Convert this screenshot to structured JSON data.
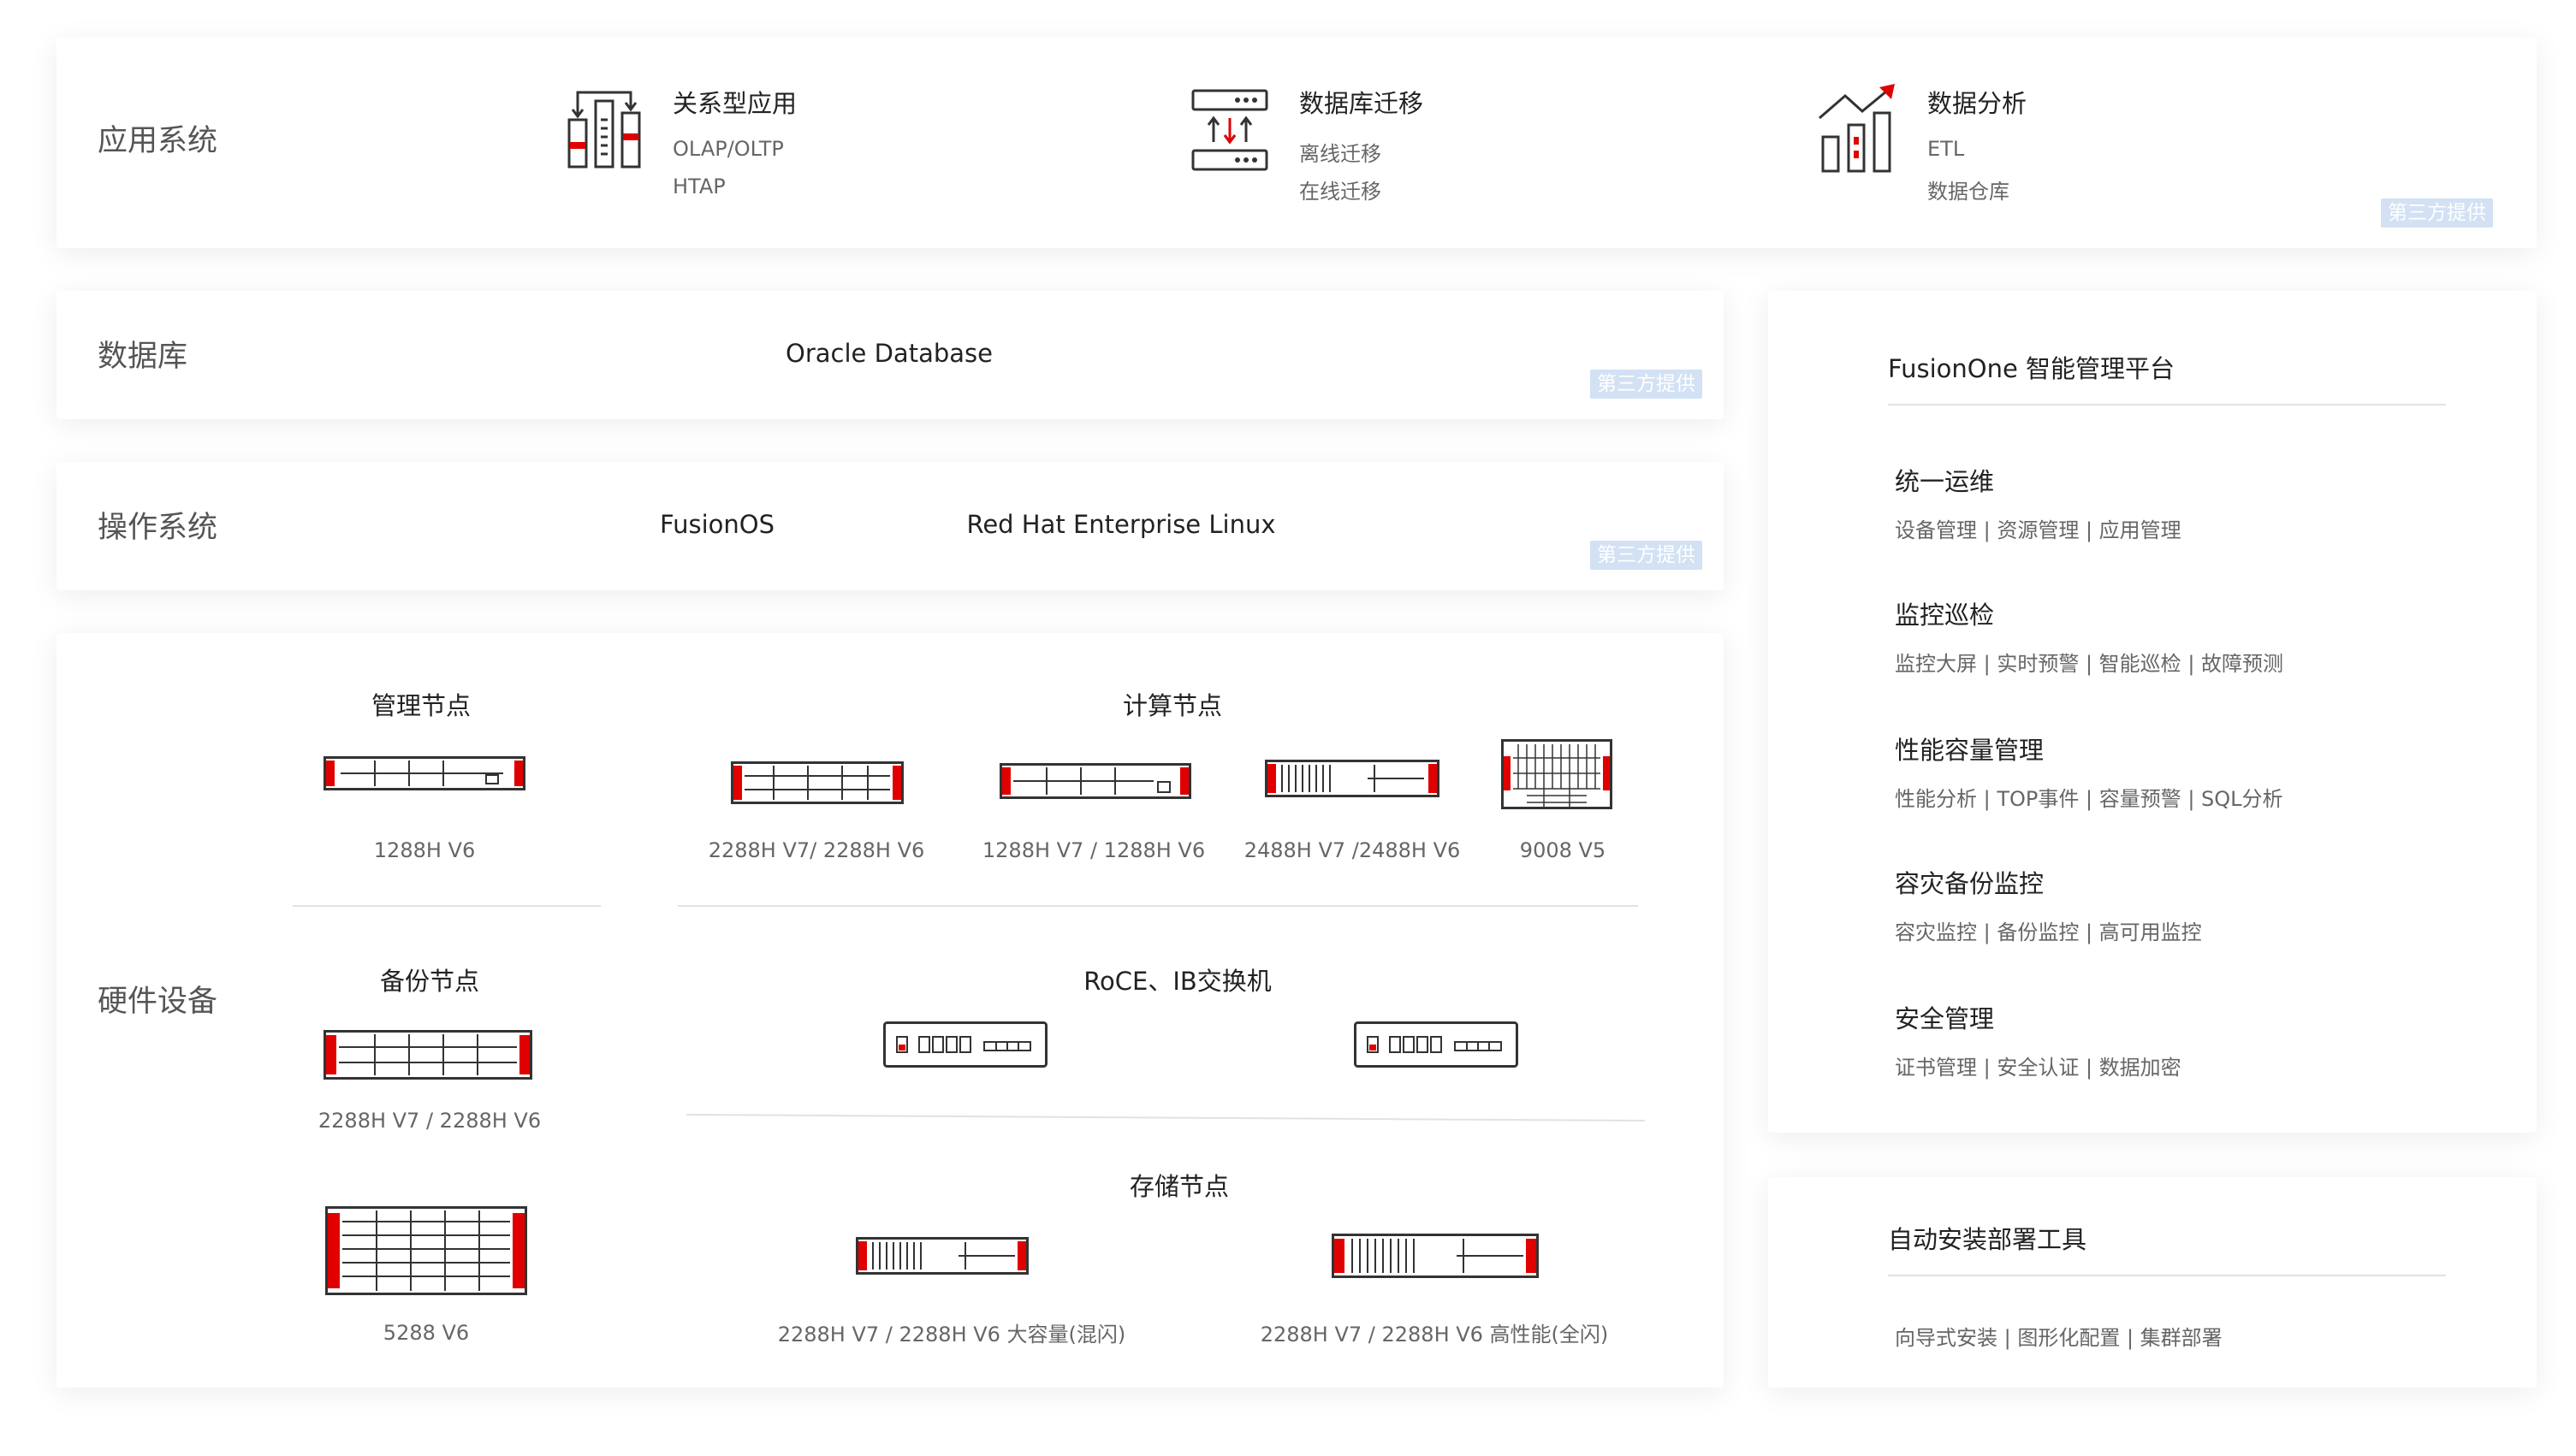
{
  "colors": {
    "accent": "#e00000",
    "outline": "#333333",
    "badge": "#d3e1f4"
  },
  "badge": "第三方提供",
  "app": {
    "label": "应用系统",
    "items": [
      {
        "icon": "relational-app-icon",
        "title": "关系型应用",
        "lines": [
          "OLAP/OLTP",
          "HTAP"
        ]
      },
      {
        "icon": "database-migration-icon",
        "title": "数据库迁移",
        "lines": [
          "离线迁移",
          "在线迁移"
        ]
      },
      {
        "icon": "data-analysis-icon",
        "title": "数据分析",
        "lines": [
          "ETL",
          "数据仓库"
        ]
      }
    ]
  },
  "database": {
    "label": "数据库",
    "items": [
      "Oracle Database"
    ]
  },
  "os": {
    "label": "操作系统",
    "items": [
      "FusionOS",
      "Red Hat Enterprise Linux"
    ]
  },
  "hardware": {
    "label": "硬件设备",
    "management": {
      "title": "管理节点",
      "devices": [
        "1288H V6"
      ]
    },
    "compute": {
      "title": "计算节点",
      "devices": [
        "2288H V7/ 2288H V6",
        "1288H V7 / 1288H V6",
        "2488H V7 /2488H V6",
        "9008 V5"
      ]
    },
    "backup": {
      "title": "备份节点",
      "devices": [
        "2288H V7 / 2288H V6",
        "5288 V6"
      ]
    },
    "switch": {
      "title": "RoCE、IB交换机"
    },
    "storage": {
      "title": "存储节点",
      "devices": [
        "2288H V7 / 2288H V6 大容量(混闪)",
        "2288H V7 / 2288H V6 高性能(全闪)"
      ]
    }
  },
  "fusionone": {
    "title": "FusionOne 智能管理平台",
    "sections": [
      {
        "title": "统一运维",
        "desc": "设备管理 | 资源管理 | 应用管理"
      },
      {
        "title": "监控巡检",
        "desc": "监控大屏 | 实时预警 | 智能巡检 | 故障预测"
      },
      {
        "title": "性能容量管理",
        "desc": "性能分析 | TOP事件 | 容量预警 | SQL分析"
      },
      {
        "title": "容灾备份监控",
        "desc": "容灾监控 | 备份监控 | 高可用监控"
      },
      {
        "title": "安全管理",
        "desc": "证书管理 | 安全认证 | 数据加密"
      }
    ]
  },
  "deploy": {
    "title": "自动安装部署工具",
    "desc": "向导式安装 | 图形化配置 | 集群部署"
  }
}
